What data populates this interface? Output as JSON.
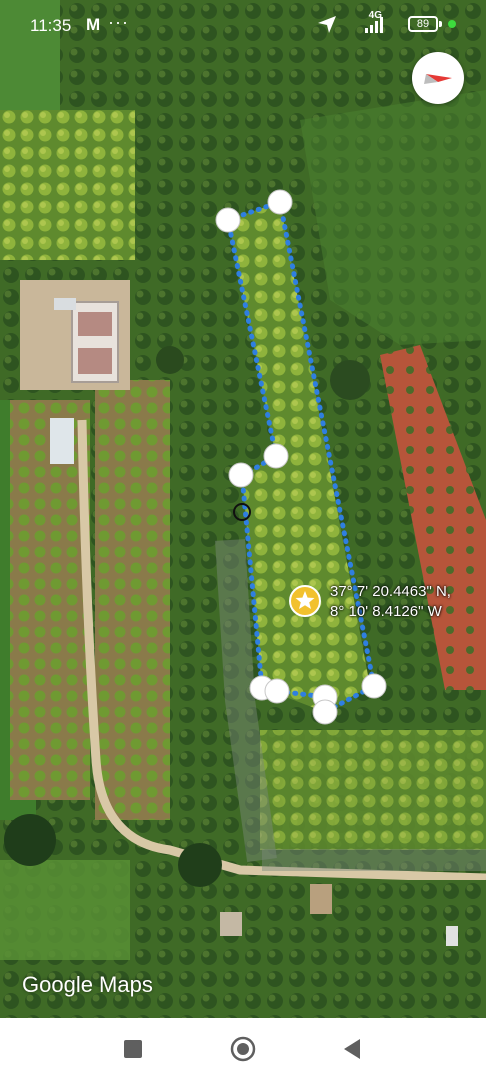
{
  "status_bar": {
    "time": "11:35",
    "notification_icon": "gmail-icon",
    "overflow": "···",
    "network": "4G",
    "battery": "89"
  },
  "map": {
    "type": "satellite",
    "marked_point": {
      "latitude": "37° 7' 20.4463\" N,",
      "longitude": "8° 10' 8.4126\" W"
    },
    "polygon_color": "#2f7fe0",
    "vertex_handle_color": "#ffffff",
    "attribution": "Google Maps"
  },
  "nav_bar": {
    "buttons": [
      "square-recents-icon",
      "circle-home-icon",
      "triangle-back-icon"
    ]
  }
}
